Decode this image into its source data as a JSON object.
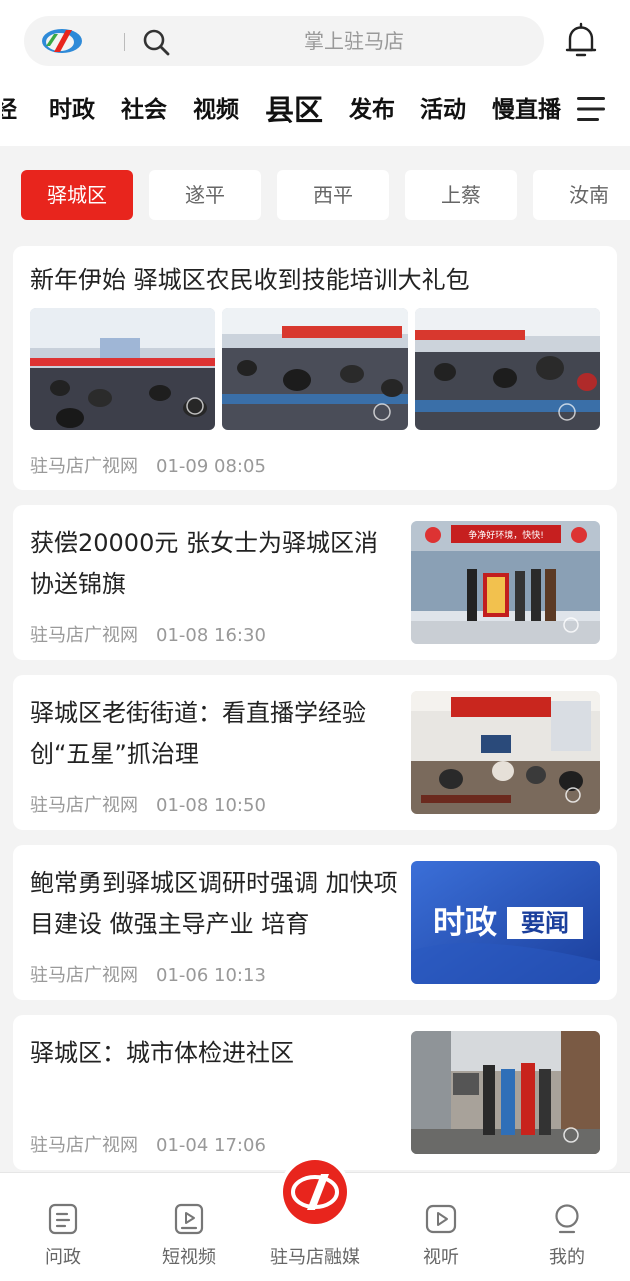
{
  "search": {
    "placeholder": "掌上驻马店"
  },
  "icons": {
    "logo": "app-logo-icon",
    "search": "search-icon",
    "bell": "bell-icon",
    "menu": "menu-icon"
  },
  "channels": [
    {
      "label": "经"
    },
    {
      "label": "时政"
    },
    {
      "label": "社会"
    },
    {
      "label": "视频"
    },
    {
      "label": "县区"
    },
    {
      "label": "发布"
    },
    {
      "label": "活动"
    },
    {
      "label": "慢直播"
    }
  ],
  "active_channel": "县区",
  "districts": [
    {
      "label": "驿城区"
    },
    {
      "label": "遂平"
    },
    {
      "label": "西平"
    },
    {
      "label": "上蔡"
    },
    {
      "label": "汝南"
    }
  ],
  "news": [
    {
      "title": "新年伊始 驿城区农民收到技能培训大礼包",
      "source": "驻马店广视网",
      "time": "01-09 08:05"
    },
    {
      "title": "获偿20000元 张女士为驿城区消协送锦旗",
      "source": "驻马店广视网",
      "time": "01-08 16:30"
    },
    {
      "title": "驿城区老街街道：看直播学经验创“五星”抓治理",
      "source": "驻马店广视网",
      "time": "01-08 10:50"
    },
    {
      "title": "鲍常勇到驿城区调研时强调 加快项目建设 做强主导产业 培育",
      "source": "驻马店广视网",
      "time": "01-06 10:13"
    },
    {
      "title": "驿城区：城市体检进社区",
      "source": "驻马店广视网",
      "time": "01-04 17:06"
    }
  ],
  "thumb_texts": {
    "banner": "争净好环境，快快!",
    "politics_a": "时政",
    "politics_b": "要闻"
  },
  "bottom_nav": [
    {
      "label": "问政",
      "icon": "document-icon"
    },
    {
      "label": "短视频",
      "icon": "short-video-icon"
    },
    {
      "label": "驻马店融媒",
      "icon": "app-logo-icon"
    },
    {
      "label": "视听",
      "icon": "play-icon"
    },
    {
      "label": "我的",
      "icon": "profile-icon"
    }
  ],
  "colors": {
    "accent": "#e8251d",
    "background": "#f3f3f3",
    "card": "#ffffff",
    "meta_text": "#999999"
  }
}
